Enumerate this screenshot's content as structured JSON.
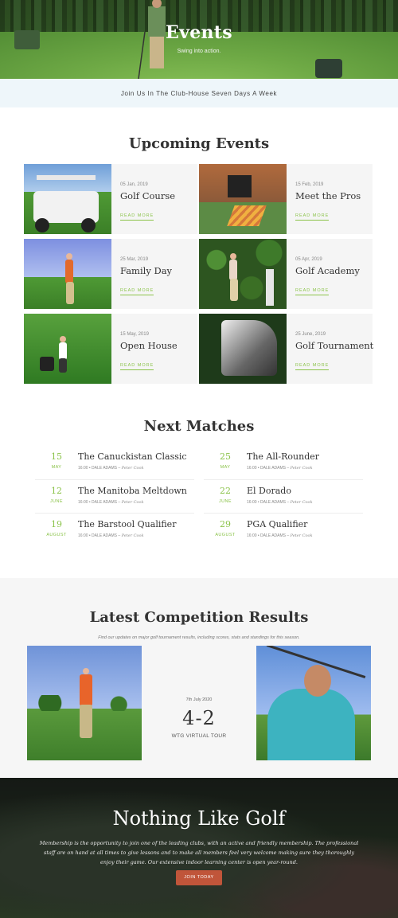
{
  "hero": {
    "title": "Events",
    "subtitle": "Swing into action."
  },
  "banner": {
    "text": "Join Us In The Club-House Seven Days A Week"
  },
  "upcoming": {
    "title": "Upcoming Events",
    "read_more": "READ MORE",
    "events": [
      {
        "date": "05 Jan, 2019",
        "name": "Golf Course"
      },
      {
        "date": "15 Feb, 2019",
        "name": "Meet the Pros"
      },
      {
        "date": "25 Mar, 2019",
        "name": "Family Day"
      },
      {
        "date": "05 Apr, 2019",
        "name": "Golf Academy"
      },
      {
        "date": "15 May, 2019",
        "name": "Open House"
      },
      {
        "date": "25 June, 2019",
        "name": "Golf Tournament"
      }
    ]
  },
  "matches": {
    "title": "Next Matches",
    "items": [
      {
        "day": "15",
        "month": "MAY",
        "title": "The Canuckistan Classic",
        "time": "16:00",
        "by": "DALE ADAMS",
        "with": "Peter Cook"
      },
      {
        "day": "25",
        "month": "MAY",
        "title": "The All-Rounder",
        "time": "16:00",
        "by": "DALE ADAMS",
        "with": "Peter Cook"
      },
      {
        "day": "12",
        "month": "JUNE",
        "title": "The Manitoba Meltdown",
        "time": "16:00",
        "by": "DALE ADAMS",
        "with": "Peter Cook"
      },
      {
        "day": "22",
        "month": "JUNE",
        "title": "El Dorado",
        "time": "16:00",
        "by": "DALE ADAMS",
        "with": "Peter Cook"
      },
      {
        "day": "19",
        "month": "AUGUST",
        "title": "The Barstool Qualifier",
        "time": "16:00",
        "by": "DALE ADAMS",
        "with": "Peter Cook"
      },
      {
        "day": "29",
        "month": "AUGUST",
        "title": "PGA Qualifier",
        "time": "16:00",
        "by": "DALE ADAMS",
        "with": "Peter Cook"
      }
    ]
  },
  "results": {
    "title": "Latest Competition Results",
    "note": "Find our updates on major golf tournament results, including scores, stats and standings for this season.",
    "date": "7th July 2020",
    "score": "4-2",
    "tour": "WTG VIRTUAL TOUR"
  },
  "cta": {
    "title": "Nothing Like Golf",
    "text": "Membership is the opportunity to join one of the leading clubs, with an active and friendly membership. The professional staff are on hand at all times to give lessons and to make all members feel very welcome making sure they thoroughly enjoy their game. Our extensive indoor learning center is open year-round.",
    "button": "JOIN TODAY"
  },
  "colors": {
    "accent_green": "#8bc34a",
    "banner_bg": "#eef6fa",
    "button": "#c0553a"
  }
}
